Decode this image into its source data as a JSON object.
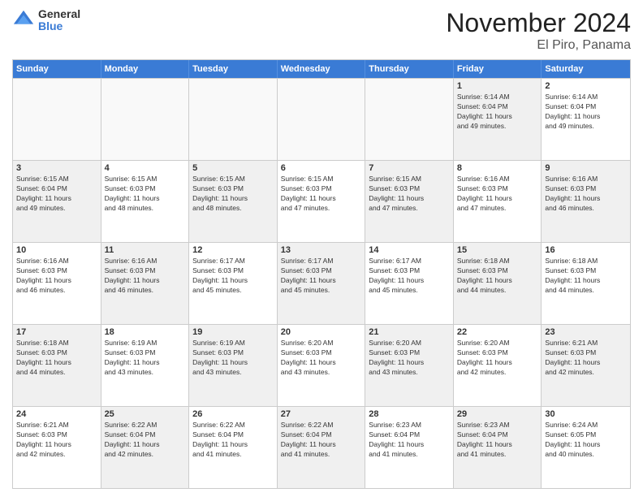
{
  "logo": {
    "general": "General",
    "blue": "Blue"
  },
  "title": "November 2024",
  "location": "El Piro, Panama",
  "header_days": [
    "Sunday",
    "Monday",
    "Tuesday",
    "Wednesday",
    "Thursday",
    "Friday",
    "Saturday"
  ],
  "weeks": [
    [
      {
        "day": "",
        "info": "",
        "empty": true
      },
      {
        "day": "",
        "info": "",
        "empty": true
      },
      {
        "day": "",
        "info": "",
        "empty": true
      },
      {
        "day": "",
        "info": "",
        "empty": true
      },
      {
        "day": "",
        "info": "",
        "empty": true
      },
      {
        "day": "1",
        "info": "Sunrise: 6:14 AM\nSunset: 6:04 PM\nDaylight: 11 hours\nand 49 minutes.",
        "shaded": true
      },
      {
        "day": "2",
        "info": "Sunrise: 6:14 AM\nSunset: 6:04 PM\nDaylight: 11 hours\nand 49 minutes.",
        "shaded": false
      }
    ],
    [
      {
        "day": "3",
        "info": "Sunrise: 6:15 AM\nSunset: 6:04 PM\nDaylight: 11 hours\nand 49 minutes.",
        "shaded": true
      },
      {
        "day": "4",
        "info": "Sunrise: 6:15 AM\nSunset: 6:03 PM\nDaylight: 11 hours\nand 48 minutes.",
        "shaded": false
      },
      {
        "day": "5",
        "info": "Sunrise: 6:15 AM\nSunset: 6:03 PM\nDaylight: 11 hours\nand 48 minutes.",
        "shaded": true
      },
      {
        "day": "6",
        "info": "Sunrise: 6:15 AM\nSunset: 6:03 PM\nDaylight: 11 hours\nand 47 minutes.",
        "shaded": false
      },
      {
        "day": "7",
        "info": "Sunrise: 6:15 AM\nSunset: 6:03 PM\nDaylight: 11 hours\nand 47 minutes.",
        "shaded": true
      },
      {
        "day": "8",
        "info": "Sunrise: 6:16 AM\nSunset: 6:03 PM\nDaylight: 11 hours\nand 47 minutes.",
        "shaded": false
      },
      {
        "day": "9",
        "info": "Sunrise: 6:16 AM\nSunset: 6:03 PM\nDaylight: 11 hours\nand 46 minutes.",
        "shaded": true
      }
    ],
    [
      {
        "day": "10",
        "info": "Sunrise: 6:16 AM\nSunset: 6:03 PM\nDaylight: 11 hours\nand 46 minutes.",
        "shaded": false
      },
      {
        "day": "11",
        "info": "Sunrise: 6:16 AM\nSunset: 6:03 PM\nDaylight: 11 hours\nand 46 minutes.",
        "shaded": true
      },
      {
        "day": "12",
        "info": "Sunrise: 6:17 AM\nSunset: 6:03 PM\nDaylight: 11 hours\nand 45 minutes.",
        "shaded": false
      },
      {
        "day": "13",
        "info": "Sunrise: 6:17 AM\nSunset: 6:03 PM\nDaylight: 11 hours\nand 45 minutes.",
        "shaded": true
      },
      {
        "day": "14",
        "info": "Sunrise: 6:17 AM\nSunset: 6:03 PM\nDaylight: 11 hours\nand 45 minutes.",
        "shaded": false
      },
      {
        "day": "15",
        "info": "Sunrise: 6:18 AM\nSunset: 6:03 PM\nDaylight: 11 hours\nand 44 minutes.",
        "shaded": true
      },
      {
        "day": "16",
        "info": "Sunrise: 6:18 AM\nSunset: 6:03 PM\nDaylight: 11 hours\nand 44 minutes.",
        "shaded": false
      }
    ],
    [
      {
        "day": "17",
        "info": "Sunrise: 6:18 AM\nSunset: 6:03 PM\nDaylight: 11 hours\nand 44 minutes.",
        "shaded": true
      },
      {
        "day": "18",
        "info": "Sunrise: 6:19 AM\nSunset: 6:03 PM\nDaylight: 11 hours\nand 43 minutes.",
        "shaded": false
      },
      {
        "day": "19",
        "info": "Sunrise: 6:19 AM\nSunset: 6:03 PM\nDaylight: 11 hours\nand 43 minutes.",
        "shaded": true
      },
      {
        "day": "20",
        "info": "Sunrise: 6:20 AM\nSunset: 6:03 PM\nDaylight: 11 hours\nand 43 minutes.",
        "shaded": false
      },
      {
        "day": "21",
        "info": "Sunrise: 6:20 AM\nSunset: 6:03 PM\nDaylight: 11 hours\nand 43 minutes.",
        "shaded": true
      },
      {
        "day": "22",
        "info": "Sunrise: 6:20 AM\nSunset: 6:03 PM\nDaylight: 11 hours\nand 42 minutes.",
        "shaded": false
      },
      {
        "day": "23",
        "info": "Sunrise: 6:21 AM\nSunset: 6:03 PM\nDaylight: 11 hours\nand 42 minutes.",
        "shaded": true
      }
    ],
    [
      {
        "day": "24",
        "info": "Sunrise: 6:21 AM\nSunset: 6:03 PM\nDaylight: 11 hours\nand 42 minutes.",
        "shaded": false
      },
      {
        "day": "25",
        "info": "Sunrise: 6:22 AM\nSunset: 6:04 PM\nDaylight: 11 hours\nand 42 minutes.",
        "shaded": true
      },
      {
        "day": "26",
        "info": "Sunrise: 6:22 AM\nSunset: 6:04 PM\nDaylight: 11 hours\nand 41 minutes.",
        "shaded": false
      },
      {
        "day": "27",
        "info": "Sunrise: 6:22 AM\nSunset: 6:04 PM\nDaylight: 11 hours\nand 41 minutes.",
        "shaded": true
      },
      {
        "day": "28",
        "info": "Sunrise: 6:23 AM\nSunset: 6:04 PM\nDaylight: 11 hours\nand 41 minutes.",
        "shaded": false
      },
      {
        "day": "29",
        "info": "Sunrise: 6:23 AM\nSunset: 6:04 PM\nDaylight: 11 hours\nand 41 minutes.",
        "shaded": true
      },
      {
        "day": "30",
        "info": "Sunrise: 6:24 AM\nSunset: 6:05 PM\nDaylight: 11 hours\nand 40 minutes.",
        "shaded": false
      }
    ]
  ]
}
